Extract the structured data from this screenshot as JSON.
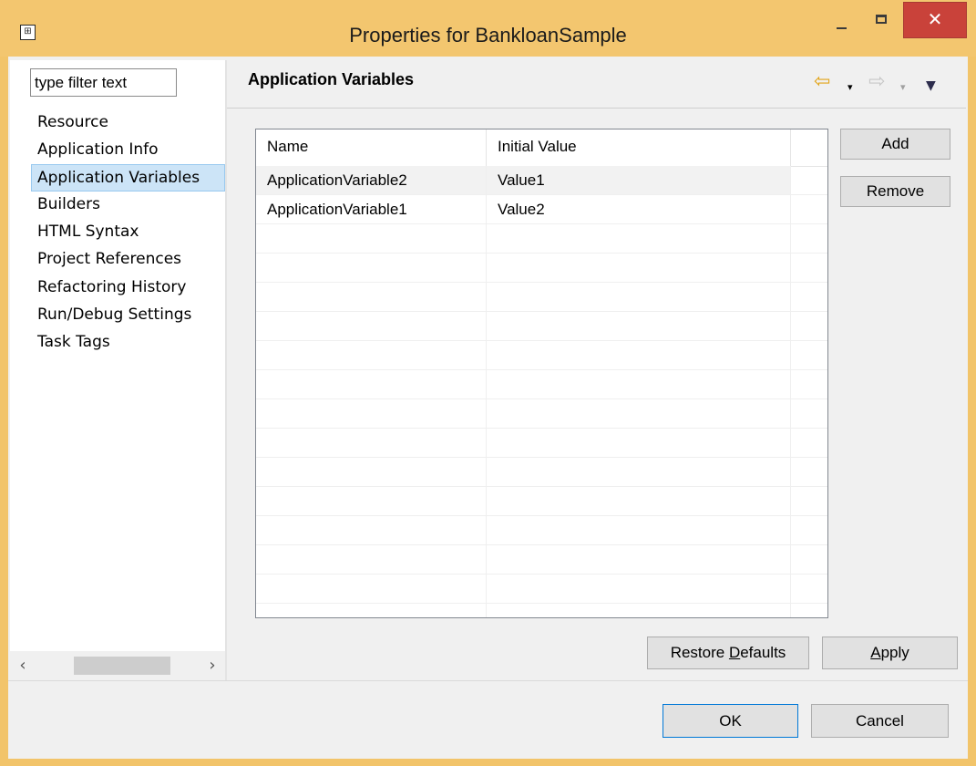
{
  "window": {
    "title": "Properties for BankloanSample",
    "icon": "properties-app-icon",
    "close_glyph": "✕"
  },
  "filter": {
    "value": "type filter text"
  },
  "nav": {
    "items": [
      {
        "label": "Resource",
        "selected": false
      },
      {
        "label": "Application Info",
        "selected": false
      },
      {
        "label": "Application Variables",
        "selected": true
      },
      {
        "label": "Builders",
        "selected": false
      },
      {
        "label": "HTML Syntax",
        "selected": false
      },
      {
        "label": "Project References",
        "selected": false
      },
      {
        "label": "Refactoring History",
        "selected": false
      },
      {
        "label": "Run/Debug Settings",
        "selected": false
      },
      {
        "label": "Task Tags",
        "selected": false
      }
    ],
    "scroll_left": "‹",
    "scroll_right": "›"
  },
  "page": {
    "title": "Application Variables"
  },
  "history": {
    "back": "⇦",
    "forward": "⇨",
    "dropdown": "▾",
    "menu": "▼"
  },
  "table": {
    "columns": [
      "Name",
      "Initial Value",
      ""
    ],
    "rows": [
      {
        "name": "ApplicationVariable2",
        "value": "Value1"
      },
      {
        "name": "ApplicationVariable1",
        "value": "Value2"
      }
    ]
  },
  "buttons": {
    "add": "Add",
    "remove": "Remove",
    "restore_pre": "Restore ",
    "restore_mn": "D",
    "restore_post": "efaults",
    "apply_mn": "A",
    "apply_post": "pply",
    "ok": "OK",
    "cancel": "Cancel"
  },
  "colors": {
    "titlebar": "#f3c66f",
    "close_button": "#c9423a",
    "selection": "#cce4f7",
    "ok_border": "#0078d7"
  }
}
